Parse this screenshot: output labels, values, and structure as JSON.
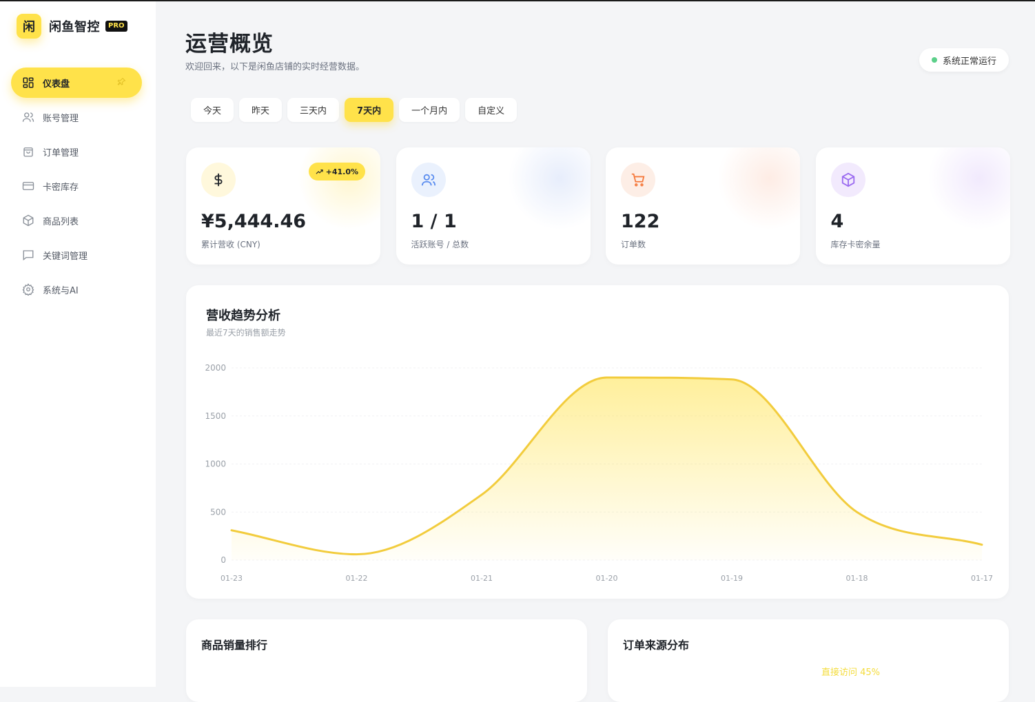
{
  "brand": {
    "logo_char": "闲",
    "name": "闲鱼智控",
    "badge": "PRO"
  },
  "sidebar": {
    "items": [
      {
        "label": "仪表盘",
        "icon": "dashboard-grid-icon",
        "active": true
      },
      {
        "label": "账号管理",
        "icon": "users-icon"
      },
      {
        "label": "订单管理",
        "icon": "shopping-bag-icon"
      },
      {
        "label": "卡密库存",
        "icon": "credit-card-icon"
      },
      {
        "label": "商品列表",
        "icon": "box-icon"
      },
      {
        "label": "关键词管理",
        "icon": "message-square-icon"
      },
      {
        "label": "系统与AI",
        "icon": "gear-icon"
      }
    ]
  },
  "header": {
    "title": "运营概览",
    "subtitle": "欢迎回来，以下是闲鱼店铺的实时经营数据。",
    "status": "系统正常运行",
    "status_color": "#5cd08a"
  },
  "range_tabs": [
    {
      "label": "今天"
    },
    {
      "label": "昨天"
    },
    {
      "label": "三天内"
    },
    {
      "label": "7天内",
      "active": true
    },
    {
      "label": "一个月内"
    },
    {
      "label": "自定义"
    }
  ],
  "stats": [
    {
      "value": "¥5,444.46",
      "label": "累计营收 (CNY)",
      "icon": "dollar-icon",
      "badge": "+41.0%",
      "accent": "#ffe24a"
    },
    {
      "value": "1 / 1",
      "label": "活跃账号 / 总数",
      "icon": "users-icon",
      "accent": "#5b8def"
    },
    {
      "value": "122",
      "label": "订单数",
      "icon": "cart-icon",
      "accent": "#f57a3d"
    },
    {
      "value": "4",
      "label": "库存卡密余量",
      "icon": "box-icon",
      "accent": "#9b6bf0"
    }
  ],
  "trend": {
    "title": "营收趋势分析",
    "subtitle": "最近7天的销售额走势"
  },
  "chart_data": {
    "type": "area",
    "categories": [
      "01-23",
      "01-22",
      "01-21",
      "01-20",
      "01-19",
      "01-18",
      "01-17"
    ],
    "values": [
      310,
      60,
      680,
      1900,
      1880,
      500,
      160
    ],
    "ylim": [
      0,
      2000
    ],
    "yticks": [
      0,
      500,
      1000,
      1500,
      2000
    ],
    "grid": true,
    "color": "#f2cc3d"
  },
  "bottom": {
    "ranking_title": "商品销量排行",
    "source_title": "订单来源分布",
    "source_label": "直接访问 45%"
  }
}
